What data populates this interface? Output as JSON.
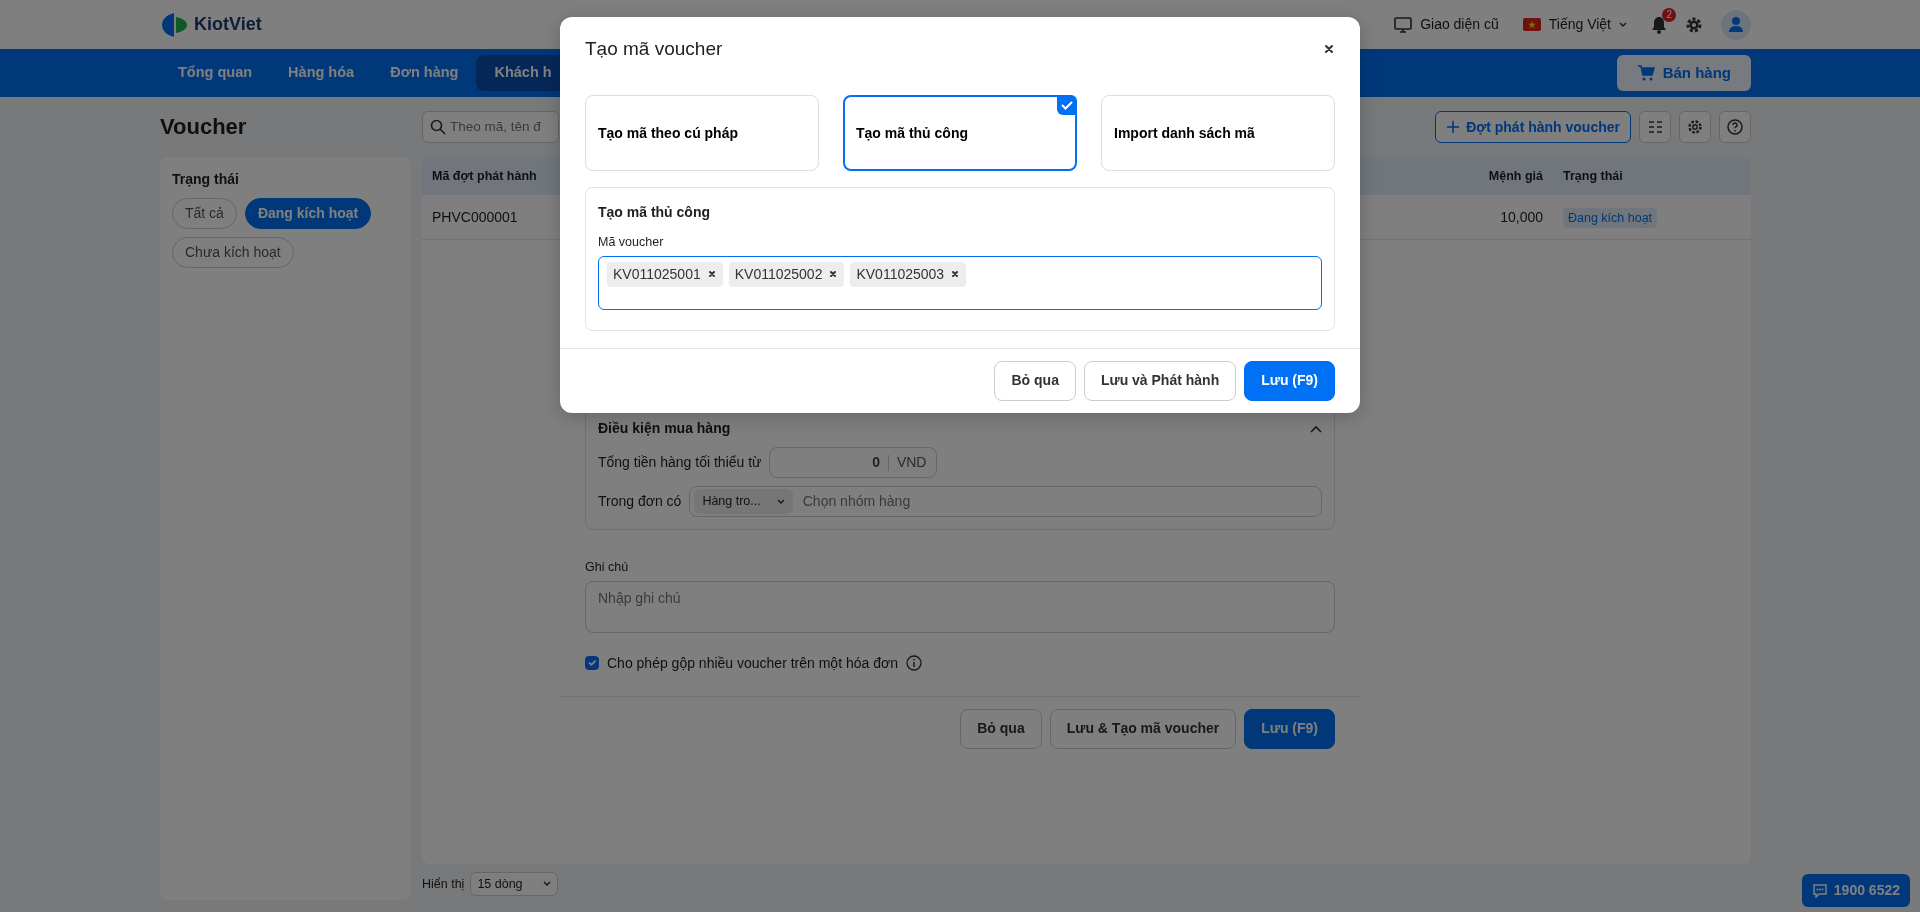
{
  "topbar": {
    "logo": "KiotViet",
    "old_ui": "Giao diện cũ",
    "language": "Tiếng Việt",
    "notifications": "2"
  },
  "menu": {
    "items": [
      {
        "label": "Tổng quan",
        "selected": false
      },
      {
        "label": "Hàng hóa",
        "selected": false
      },
      {
        "label": "Đơn hàng",
        "selected": false
      },
      {
        "label": "Khách h",
        "selected": true
      }
    ],
    "sell_button": "Bán hàng"
  },
  "page": {
    "title": "Voucher",
    "search": {
      "placeholder": "Theo mã, tên đ"
    },
    "create_button": "Đợt phát hành voucher"
  },
  "filter": {
    "title": "Trạng thái",
    "options": [
      {
        "label": "Tất cả",
        "selected": false
      },
      {
        "label": "Đang kích hoạt",
        "selected": true
      },
      {
        "label": "Chưa kích hoạt",
        "selected": false
      }
    ]
  },
  "table": {
    "columns": [
      "Mã đợt phát hành",
      "Mệnh giá",
      "Trạng thái"
    ],
    "rows": [
      {
        "code": "PHVC000001",
        "value": "10,000",
        "status": "Đang kích hoạt"
      }
    ]
  },
  "pagination": {
    "label": "Hiển thị",
    "page_size": "15 dòng"
  },
  "hotline": "1900 6522",
  "issue_dialog": {
    "section_title": "Điều kiện mua hàng",
    "expanded": true,
    "min_total_label": "Tổng tiền hàng tối thiểu từ",
    "min_total_value": "0",
    "currency": "VND",
    "order_contains_label": "Trong đơn có",
    "order_contains_mode": "Hàng tro...",
    "group_placeholder": "Chọn nhóm hàng",
    "note_label": "Ghi chú",
    "note_placeholder": "Nhập ghi chú",
    "allow_combine": {
      "label": "Cho phép gộp nhiều voucher trên một hóa đơn",
      "checked": true
    },
    "buttons": [
      {
        "label": "Bỏ qua",
        "kind": "secondary"
      },
      {
        "label": "Lưu & Tạo mã voucher",
        "kind": "secondary"
      },
      {
        "label": "Lưu (F9)",
        "kind": "primary"
      }
    ]
  },
  "voucher_dialog": {
    "title": "Tạo mã voucher",
    "methods": [
      {
        "label": "Tạo mã theo cú pháp",
        "selected": false
      },
      {
        "label": "Tạo mã thủ công",
        "selected": true
      },
      {
        "label": "Import danh sách mã",
        "selected": false
      }
    ],
    "section_title": "Tạo mã thủ công",
    "field_label": "Mã voucher",
    "codes": [
      "KV011025001",
      "KV011025002",
      "KV011025003"
    ],
    "buttons": [
      {
        "label": "Bỏ qua",
        "kind": "secondary"
      },
      {
        "label": "Lưu và Phát hành",
        "kind": "secondary"
      },
      {
        "label": "Lưu (F9)",
        "kind": "primary"
      }
    ]
  }
}
